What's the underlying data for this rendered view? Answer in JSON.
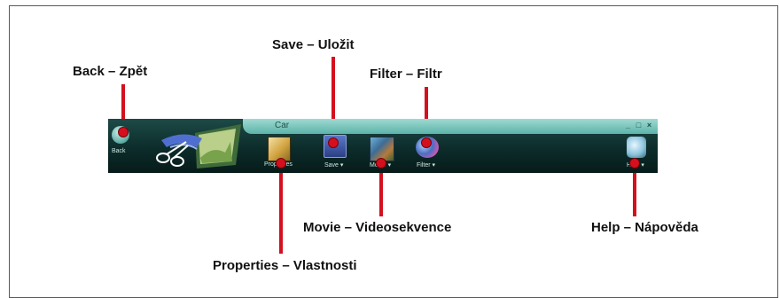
{
  "callouts": {
    "back": "Back – Zpět",
    "save": "Save – Uložit",
    "filter": "Filter – Filtr",
    "movie": "Movie – Videosekvence",
    "help": "Help – Nápověda",
    "properties": "Properties – Vlastnosti"
  },
  "toolbar": {
    "title": "Car",
    "back_label": "Back",
    "properties_label": "Properties",
    "save_label": "Save ▾",
    "movie_label": "Movie ▾",
    "filter_label": "Filter ▾",
    "help_label": "Help ▾",
    "window_controls": [
      "_",
      "□",
      "×"
    ]
  },
  "colors": {
    "callout_red": "#d4101f",
    "toolbar_dark": "#0c2c2a",
    "titlebar_teal": "#7cc9bf"
  }
}
